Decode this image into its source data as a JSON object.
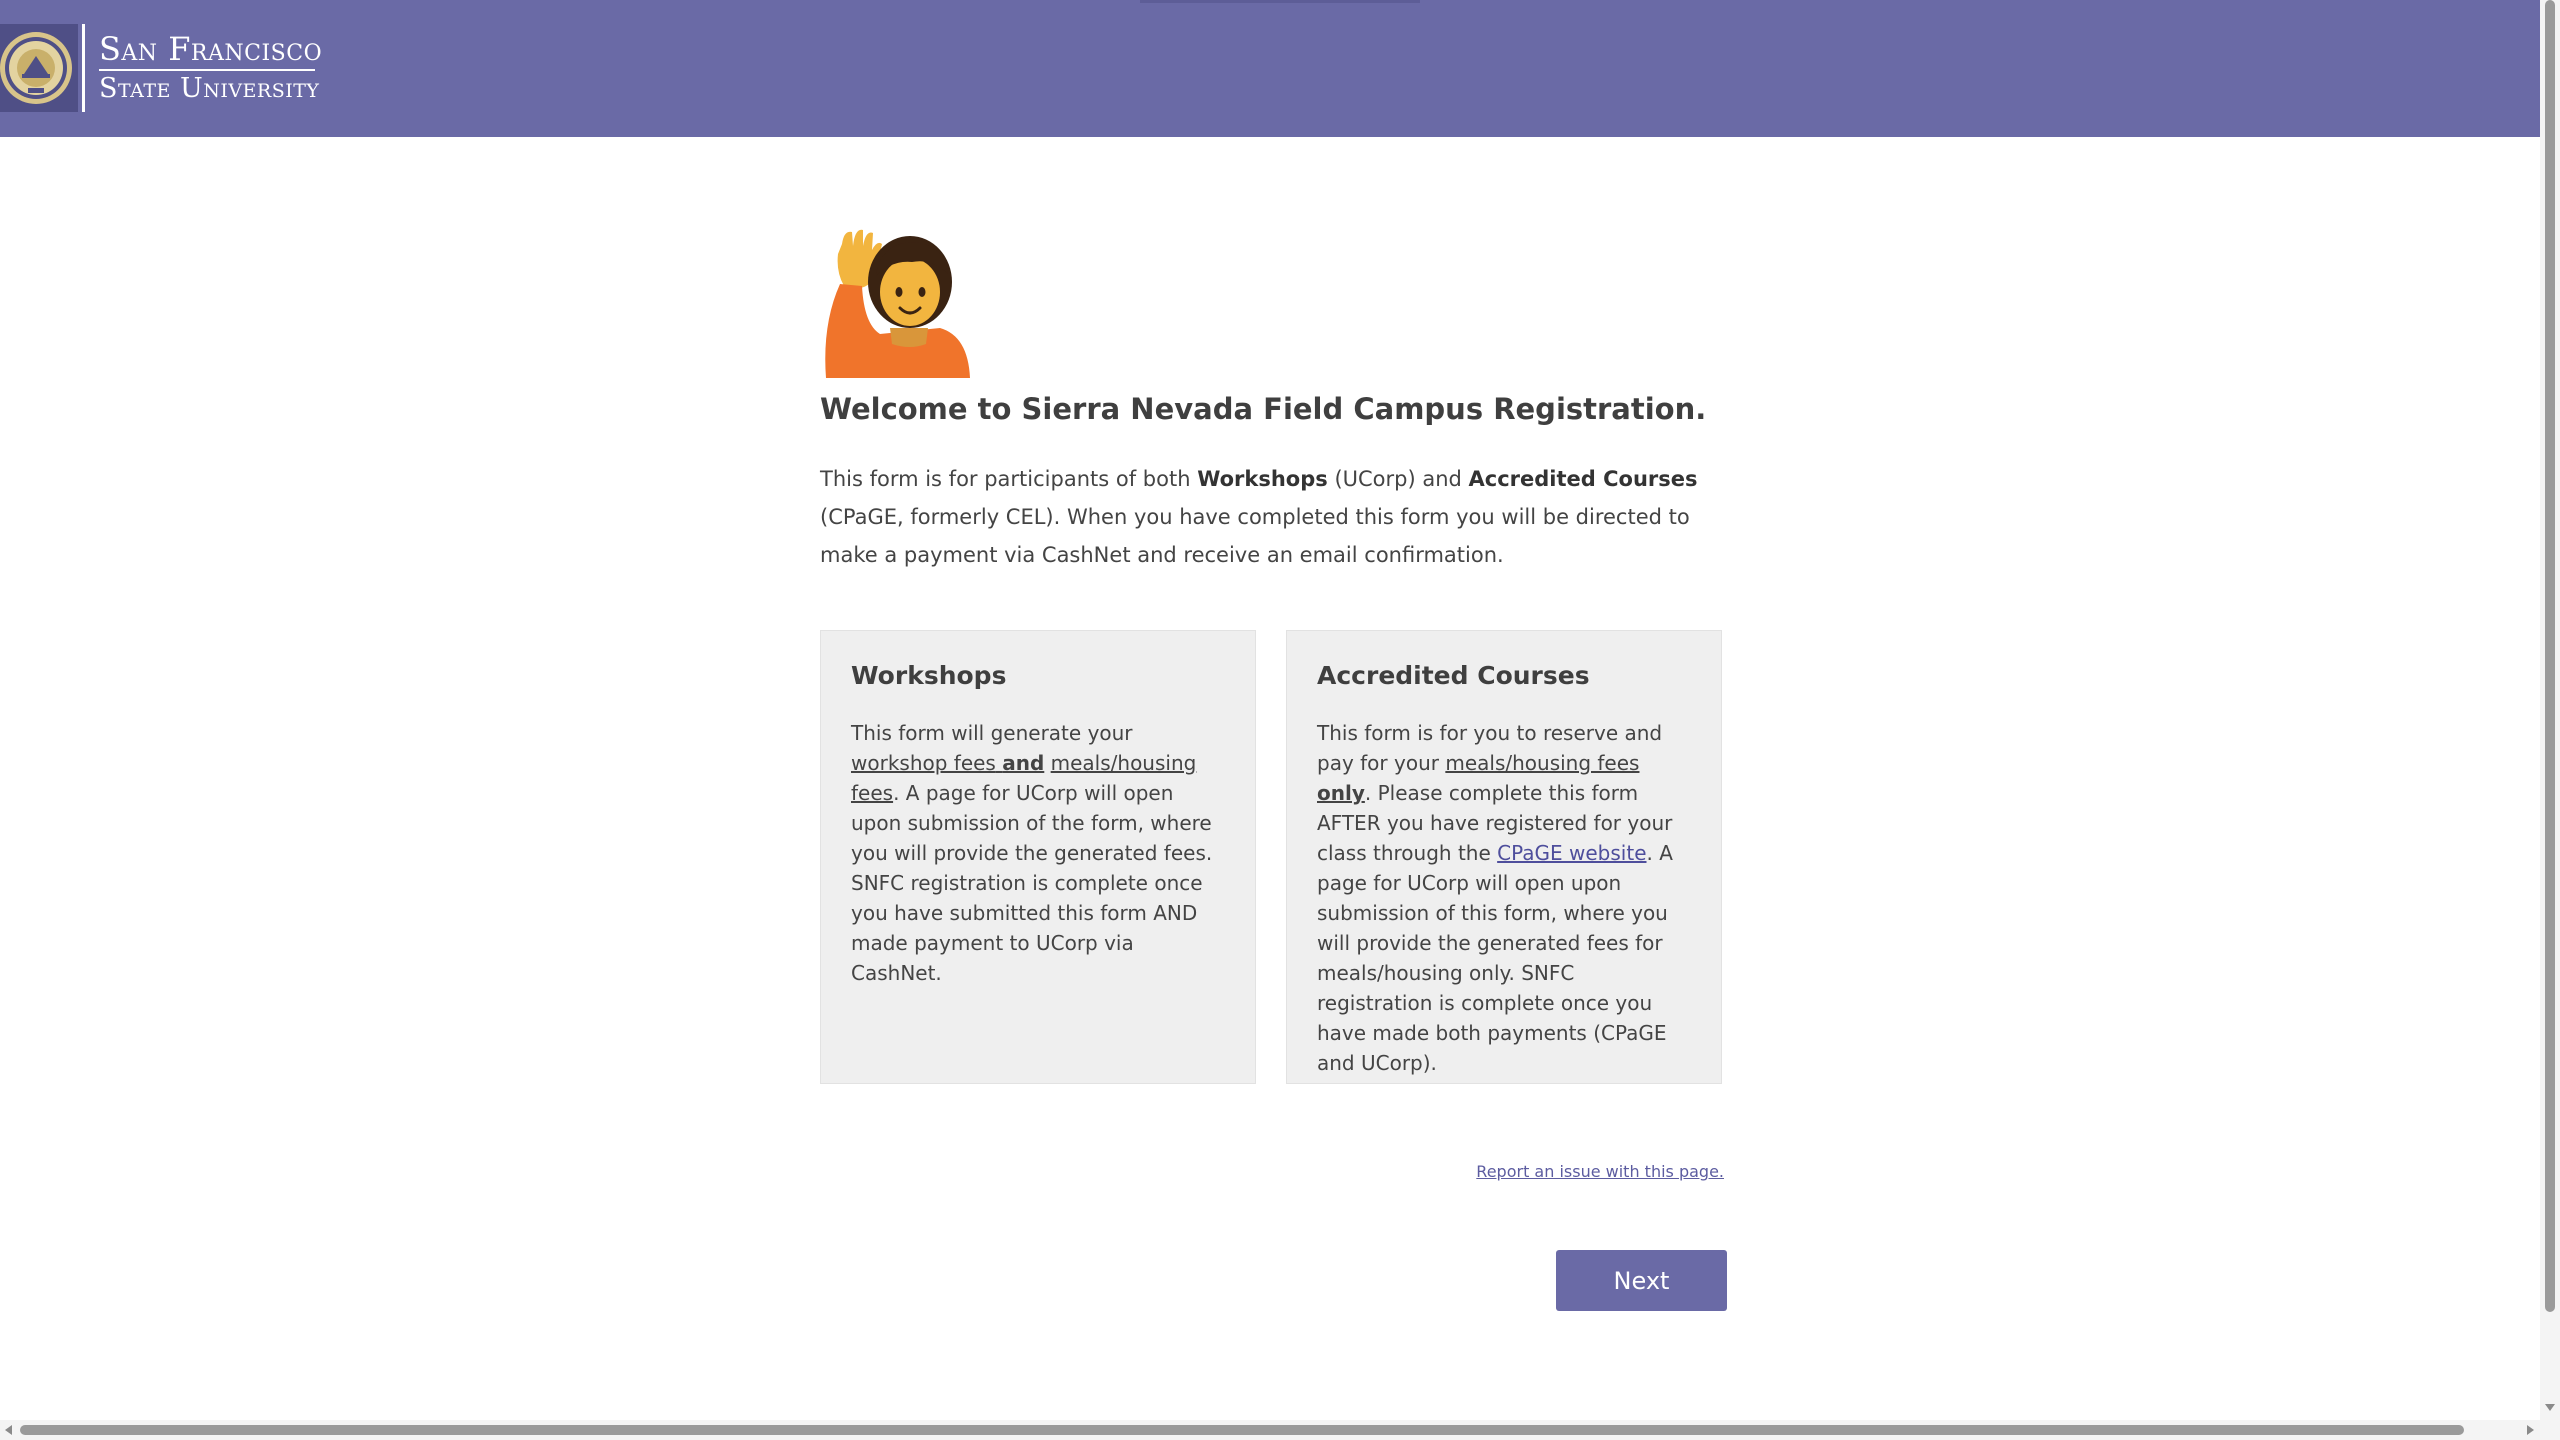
{
  "header": {
    "logo_line1": "San Francisco",
    "logo_line2": "State University",
    "seal_icon": "university-seal-icon",
    "bg_color": "#6a6aa6"
  },
  "main": {
    "emoji_icon": "person-raising-hand-emoji",
    "title": "Welcome to Sierra Nevada Field Campus Registration.",
    "intro": {
      "t1": "This form is for participants of both ",
      "b1": "Workshops",
      "t2": " (UCorp) and ",
      "b2": "Accredited Courses",
      "t3": " (CPaGE, formerly CEL). When you have completed this form you will be directed to make a payment via CashNet and receive an email confirmation."
    }
  },
  "cards": {
    "workshops": {
      "title": "Workshops",
      "t1": "This form will generate your ",
      "u1": "workshop fees",
      "t2": " ",
      "bu1": "and",
      "t3": " ",
      "u2": "meals/housing fees",
      "t4": ". A page for UCorp will open upon submission of the form, where you will provide the generated fees. SNFC registration is complete once you have submitted this form AND made payment to UCorp via CashNet."
    },
    "accredited": {
      "title": "Accredited Courses",
      "t1": "This form is for you to reserve and pay for your ",
      "u1": "meals/housing fees",
      "t2": " ",
      "bu1": "only",
      "t3": ". Please complete this form AFTER you have registered for your class through the ",
      "link": "CPaGE website",
      "t4": ". A page for UCorp will open upon submission of this form, where you will provide the generated fees for meals/housing only. SNFC registration is complete once you have made both payments (CPaGE and UCorp)."
    }
  },
  "footer": {
    "report_link": "Report an issue with this page.",
    "next_label": "Next",
    "accent_color": "#6a6aa6"
  }
}
